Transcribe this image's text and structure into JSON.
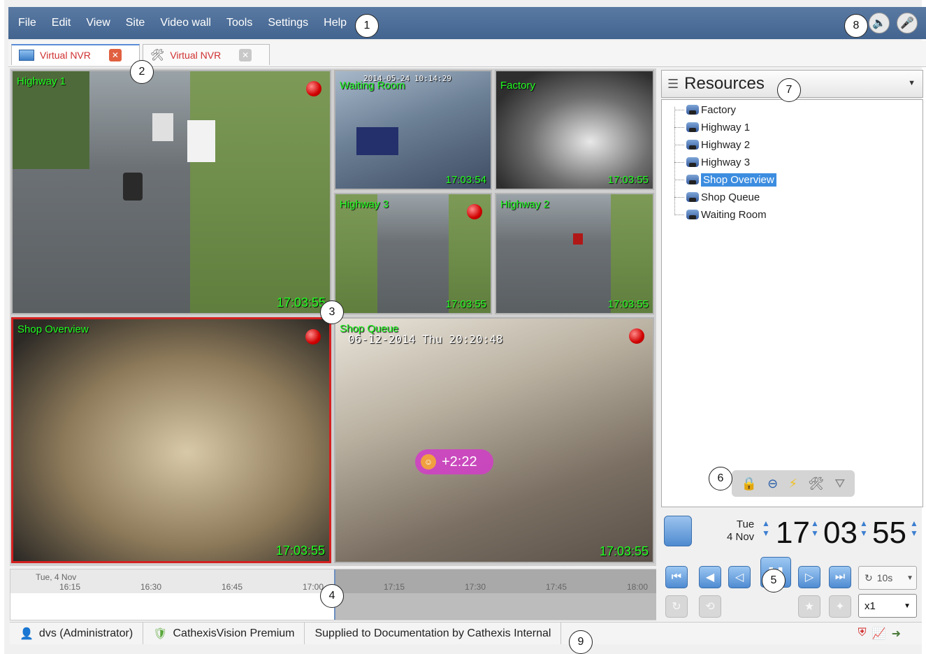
{
  "menu": {
    "items": [
      "File",
      "Edit",
      "View",
      "Site",
      "Video wall",
      "Tools",
      "Settings",
      "Help"
    ],
    "right_icons": [
      "speaker-icon",
      "microphone-icon"
    ]
  },
  "tabs": [
    {
      "label": "Virtual NVR",
      "icon": "monitor-icon",
      "active": true
    },
    {
      "label": "Virtual NVR",
      "icon": "tools-icon",
      "active": false
    }
  ],
  "cameras": {
    "highway1": {
      "label": "Highway 1",
      "time": "17:03:55"
    },
    "waiting": {
      "label": "Waiting Room",
      "time": "17:03:54",
      "osd": "2014-05-24 10:14:29"
    },
    "factory": {
      "label": "Factory",
      "time": "17:03:55"
    },
    "highway3": {
      "label": "Highway 3",
      "time": "17:03:55"
    },
    "highway2": {
      "label": "Highway 2",
      "time": "17:03:55"
    },
    "shop_overview": {
      "label": "Shop Overview",
      "time": "17:03:55"
    },
    "shop_queue": {
      "label": "Shop Queue",
      "time": "17:03:55",
      "osd": "06-12-2014 Thu 20:20:48",
      "timer": "+2:22"
    }
  },
  "timeline": {
    "date": "Tue, 4 Nov",
    "ticks": [
      "16:15",
      "16:30",
      "16:45",
      "17:00",
      "17:15",
      "17:30",
      "17:45",
      "18:00"
    ]
  },
  "resources": {
    "title": "Resources",
    "items": [
      "Factory",
      "Highway 1",
      "Highway 2",
      "Highway 3",
      "Shop Overview",
      "Shop Queue",
      "Waiting Room"
    ],
    "selected": "Shop Overview"
  },
  "clock": {
    "day": "Tue",
    "date": "4 Nov",
    "hours": "17",
    "minutes": "03",
    "seconds": "55"
  },
  "playback": {
    "loop": "10s",
    "speed": "x1"
  },
  "status": {
    "user": "dvs (Administrator)",
    "product": "CathexisVision Premium",
    "license": "Supplied to Documentation by Cathexis Internal"
  },
  "callouts": [
    "1",
    "2",
    "3",
    "4",
    "5",
    "6",
    "7",
    "8",
    "9"
  ],
  "colors": {
    "menu_bar": "#4a6c98",
    "camera_text": "#22ff22",
    "selection": "#3c8de0",
    "record": "#d00000"
  }
}
